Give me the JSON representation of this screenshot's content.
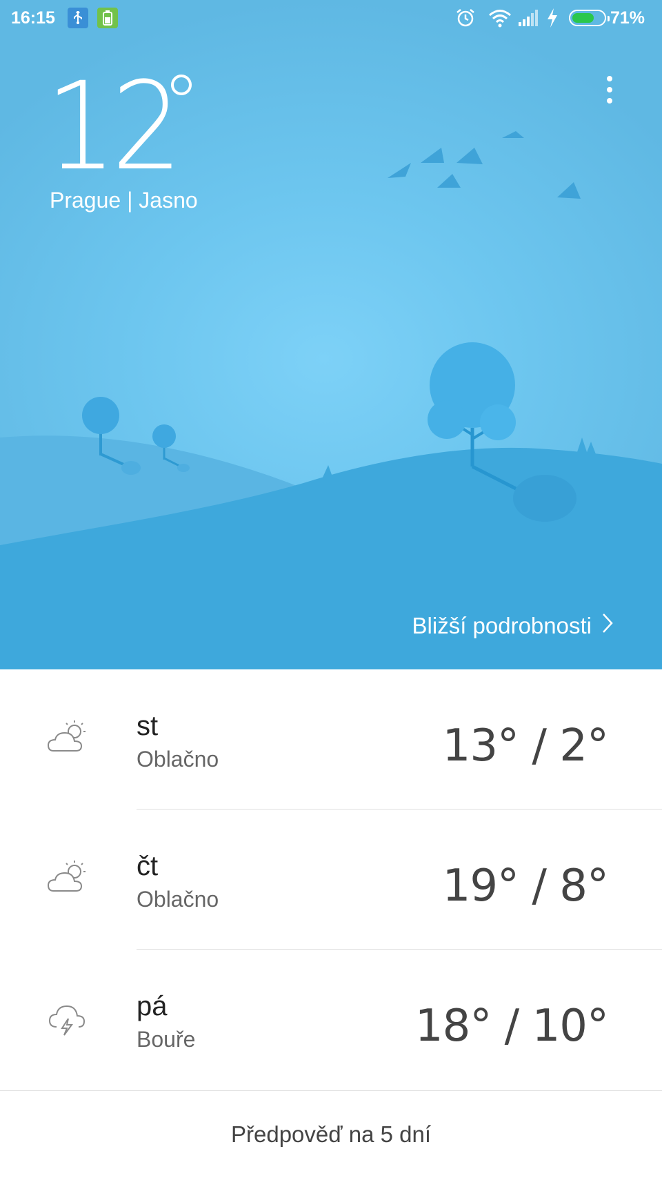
{
  "status_bar": {
    "time": "16:15",
    "battery_percent": "71%",
    "battery_level": 0.71,
    "icons": [
      "usb-icon",
      "battery-notification-icon",
      "alarm-icon",
      "wifi-icon",
      "signal-icon",
      "charging-icon",
      "battery-icon"
    ]
  },
  "weather": {
    "temperature": "12",
    "location_line": "Prague | Jasno",
    "details_label": "Bližší podrobnosti"
  },
  "forecast": {
    "days": [
      {
        "day": "st",
        "condition": "Oblačno",
        "temps": "13° / 2°",
        "icon": "partly-cloudy-icon"
      },
      {
        "day": "čt",
        "condition": "Oblačno",
        "temps": "19° / 8°",
        "icon": "partly-cloudy-icon"
      },
      {
        "day": "pá",
        "condition": "Bouře",
        "temps": "18° / 10°",
        "icon": "thunderstorm-icon"
      }
    ],
    "five_day_label": "Předpověď na 5 dní"
  },
  "colors": {
    "sky": "#6dc6ef",
    "hill_back": "#5ab5e3",
    "hill_front": "#3ea8dc",
    "battery_green": "#2ac74c"
  }
}
